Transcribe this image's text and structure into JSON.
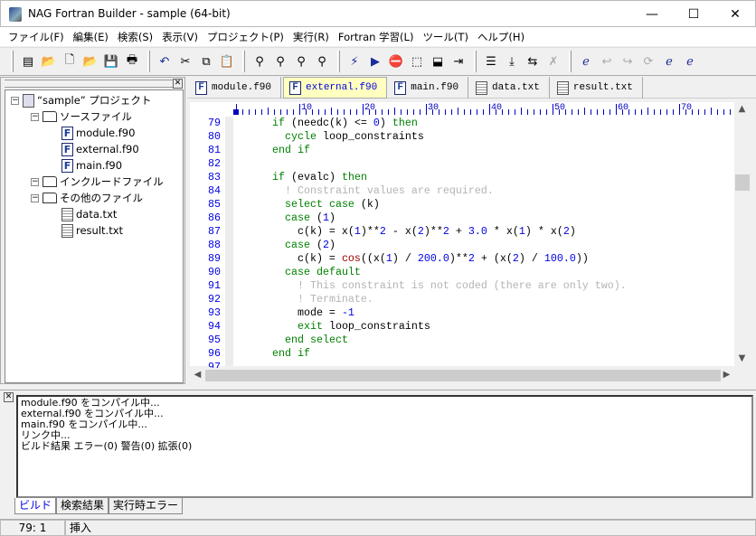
{
  "window": {
    "title": "NAG Fortran Builder - sample (64-bit)"
  },
  "menu": [
    "ファイル(F)",
    "編集(E)",
    "検索(S)",
    "表示(V)",
    "プロジェクト(P)",
    "実行(R)",
    "Fortran 学習(L)",
    "ツール(T)",
    "ヘルプ(H)"
  ],
  "toolbar": {
    "groups": [
      [
        "new-project-icon",
        "open-folder-icon",
        "new-file-icon",
        "open-file-icon",
        "save-icon",
        "print-icon"
      ],
      [
        "undo-icon",
        "cut-icon",
        "copy-icon",
        "paste-icon"
      ],
      [
        "find-icon",
        "find-next-icon",
        "find-previous-icon",
        "find-in-files-icon"
      ],
      [
        "build-icon",
        "run-icon",
        "stop-icon",
        "step-over-icon",
        "step-into-icon",
        "run-to-cursor-icon"
      ],
      [
        "indent-icon",
        "import-icon",
        "export-icon",
        "clear-icon"
      ],
      [
        "e-learning-icon",
        "back-icon",
        "forward-icon",
        "refresh-icon",
        "search-e-icon",
        "edit-e-icon"
      ]
    ]
  },
  "tree": [
    {
      "label": "“sample” プロジェクト",
      "type": "project",
      "level": 0
    },
    {
      "label": "ソースファイル",
      "type": "folder",
      "level": 1
    },
    {
      "label": "module.f90",
      "type": "fortran",
      "level": 2
    },
    {
      "label": "external.f90",
      "type": "fortran",
      "level": 2
    },
    {
      "label": "main.f90",
      "type": "fortran",
      "level": 2
    },
    {
      "label": "インクルードファイル",
      "type": "folder",
      "level": 1
    },
    {
      "label": "その他のファイル",
      "type": "folder",
      "level": 1
    },
    {
      "label": "data.txt",
      "type": "text",
      "level": 2
    },
    {
      "label": "result.txt",
      "type": "text",
      "level": 2
    }
  ],
  "tabs": [
    {
      "label": "module.f90",
      "type": "fortran",
      "active": false
    },
    {
      "label": "external.f90",
      "type": "fortran",
      "active": true
    },
    {
      "label": "main.f90",
      "type": "fortran",
      "active": false
    },
    {
      "label": "data.txt",
      "type": "text",
      "active": false
    },
    {
      "label": "result.txt",
      "type": "text",
      "active": false
    }
  ],
  "ruler": [
    "10",
    "20",
    "30",
    "40",
    "50",
    "60",
    "70"
  ],
  "code": [
    {
      "n": "79",
      "t": [
        [
          "    ",
          ""
        ],
        [
          "if",
          "kw"
        ],
        [
          " (needc(k) <= ",
          ""
        ],
        [
          "0",
          "n"
        ],
        [
          ") ",
          ""
        ],
        [
          "then",
          "kw"
        ]
      ]
    },
    {
      "n": "80",
      "t": [
        [
          "      ",
          ""
        ],
        [
          "cycle",
          "kw"
        ],
        [
          " loop_constraints",
          ""
        ]
      ]
    },
    {
      "n": "81",
      "t": [
        [
          "    ",
          ""
        ],
        [
          "end if",
          "kw"
        ]
      ]
    },
    {
      "n": "82",
      "t": []
    },
    {
      "n": "83",
      "t": [
        [
          "    ",
          ""
        ],
        [
          "if",
          "kw"
        ],
        [
          " (evalc) ",
          ""
        ],
        [
          "then",
          "kw"
        ]
      ]
    },
    {
      "n": "84",
      "t": [
        [
          "      ",
          ""
        ],
        [
          "! Constraint values are required.",
          "cm"
        ]
      ]
    },
    {
      "n": "85",
      "t": [
        [
          "      ",
          ""
        ],
        [
          "select case",
          "kw"
        ],
        [
          " (k)",
          ""
        ]
      ]
    },
    {
      "n": "86",
      "t": [
        [
          "      ",
          ""
        ],
        [
          "case",
          "kw"
        ],
        [
          " (",
          ""
        ],
        [
          "1",
          "n"
        ],
        [
          ")",
          ""
        ]
      ]
    },
    {
      "n": "87",
      "t": [
        [
          "        c(k) = x(",
          ""
        ],
        [
          "1",
          "n"
        ],
        [
          ")**",
          ""
        ],
        [
          "2",
          "n"
        ],
        [
          " - x(",
          ""
        ],
        [
          "2",
          "n"
        ],
        [
          ")**",
          ""
        ],
        [
          "2",
          "n"
        ],
        [
          " + ",
          ""
        ],
        [
          "3.0",
          "n"
        ],
        [
          " * x(",
          ""
        ],
        [
          "1",
          "n"
        ],
        [
          ") * x(",
          ""
        ],
        [
          "2",
          "n"
        ],
        [
          ")",
          ""
        ]
      ]
    },
    {
      "n": "88",
      "t": [
        [
          "      ",
          ""
        ],
        [
          "case",
          "kw"
        ],
        [
          " (",
          ""
        ],
        [
          "2",
          "n"
        ],
        [
          ")",
          ""
        ]
      ]
    },
    {
      "n": "89",
      "t": [
        [
          "        c(k) = ",
          ""
        ],
        [
          "cos",
          "fn"
        ],
        [
          "((x(",
          ""
        ],
        [
          "1",
          "n"
        ],
        [
          ") / ",
          ""
        ],
        [
          "200.0",
          "n"
        ],
        [
          ")**",
          ""
        ],
        [
          "2",
          "n"
        ],
        [
          " + (x(",
          ""
        ],
        [
          "2",
          "n"
        ],
        [
          ") / ",
          ""
        ],
        [
          "100.0",
          "n"
        ],
        [
          "))",
          ""
        ]
      ]
    },
    {
      "n": "90",
      "t": [
        [
          "      ",
          ""
        ],
        [
          "case default",
          "kw"
        ]
      ]
    },
    {
      "n": "91",
      "t": [
        [
          "        ",
          ""
        ],
        [
          "! This constraint is not coded (there are only two).",
          "cm"
        ]
      ]
    },
    {
      "n": "92",
      "t": [
        [
          "        ",
          ""
        ],
        [
          "! Terminate.",
          "cm"
        ]
      ]
    },
    {
      "n": "93",
      "t": [
        [
          "        mode = ",
          ""
        ],
        [
          "-1",
          "n"
        ]
      ]
    },
    {
      "n": "94",
      "t": [
        [
          "        ",
          ""
        ],
        [
          "exit",
          "kw"
        ],
        [
          " loop_constraints",
          ""
        ]
      ]
    },
    {
      "n": "95",
      "t": [
        [
          "      ",
          ""
        ],
        [
          "end select",
          "kw"
        ]
      ]
    },
    {
      "n": "96",
      "t": [
        [
          "    ",
          ""
        ],
        [
          "end if",
          "kw"
        ]
      ]
    },
    {
      "n": "97",
      "t": []
    }
  ],
  "output": [
    "module.f90 をコンパイル中...",
    "external.f90 をコンパイル中...",
    "main.f90 をコンパイル中...",
    "リンク中...",
    "ビルド結果 エラー(0) 警告(0) 拡張(0)"
  ],
  "bottom_tabs": [
    {
      "label": "ビルド",
      "active": true
    },
    {
      "label": "検索結果",
      "active": false
    },
    {
      "label": "実行時エラー",
      "active": false
    }
  ],
  "status": {
    "position": "79:  1",
    "mode": "挿入"
  },
  "colors": {
    "keyword": "#008000",
    "number": "#0000e0",
    "function": "#a00000",
    "comment": "#b4b4b4",
    "active_tab": "#ffffc0"
  }
}
